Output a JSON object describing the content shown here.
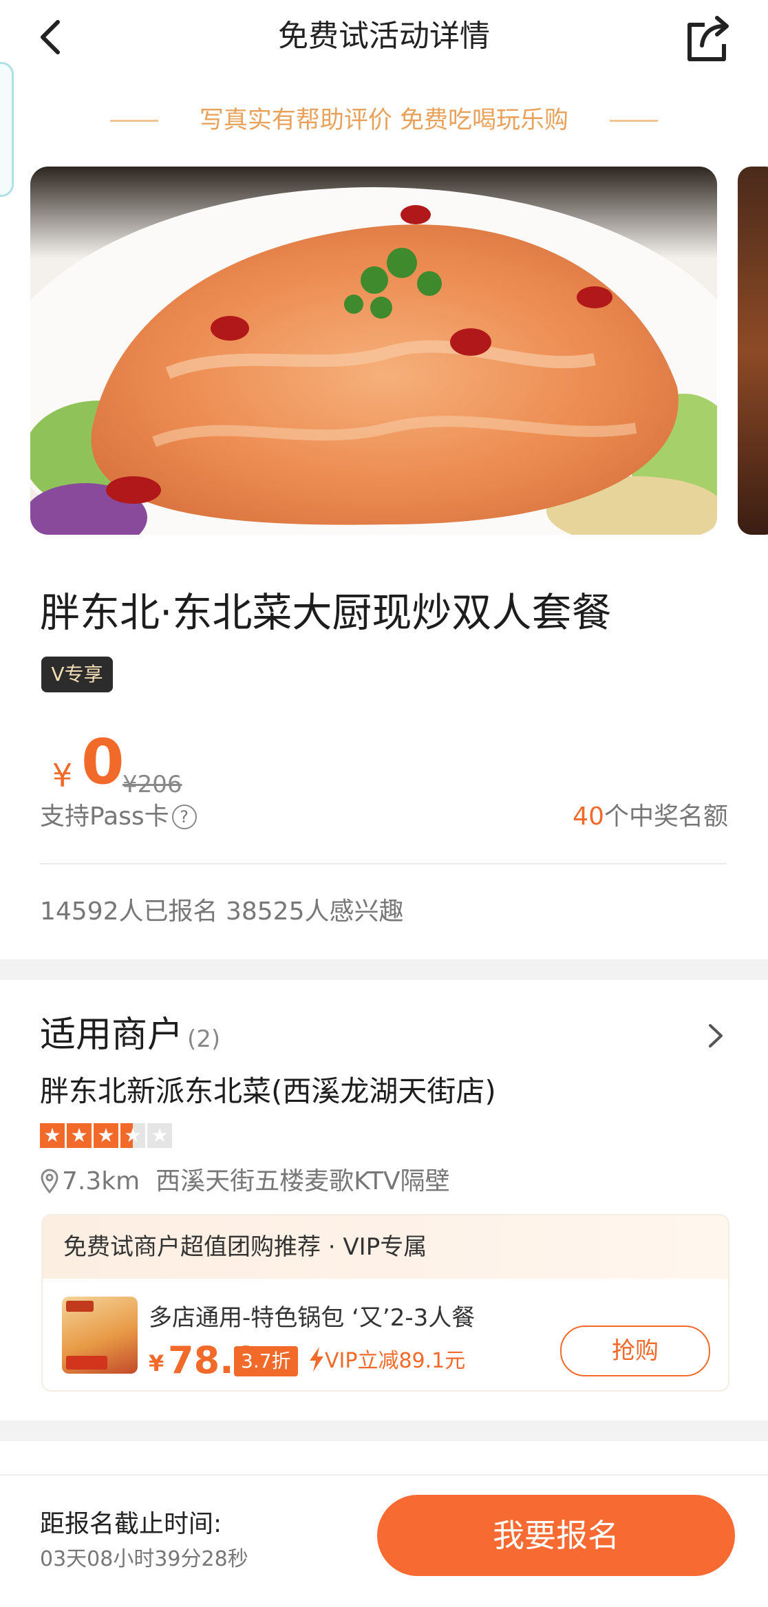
{
  "header": {
    "title": "免费试活动详情"
  },
  "slogan": "写真实有帮助评价 免费吃喝玩乐购",
  "product": {
    "name": "胖东北·东北菜大厨现炒双人套餐",
    "badge": "V专享",
    "currency": "¥",
    "price": "0",
    "original_price": "¥206",
    "pass_text": "支持Pass卡",
    "quota_number": "40",
    "quota_suffix": "个中奖名额",
    "stats": "14592人已报名  38525人感兴趣"
  },
  "merchants": {
    "title": "适用商户",
    "count": "(2)",
    "shop_name": "胖东北新派东北菜(西溪龙湖天街店)",
    "rating": 3.5,
    "rating_max": 5,
    "distance": "7.3km",
    "address": "西溪天街五楼麦歌KTV隔壁"
  },
  "deal": {
    "header": "免费试商户超值团购推荐 · VIP专属",
    "name": "多店通用-特色锅包 ‘又’2-3人餐",
    "currency": "¥",
    "price": "78.9",
    "discount": "3.7折",
    "vip": "VIP立减89.1元",
    "buy_label": "抢购"
  },
  "footer": {
    "deadline_label": "距报名截止时间:",
    "deadline_value": "03天08小时39分28秒",
    "signup_label": "我要报名"
  },
  "colors": {
    "accent": "#f26a2a",
    "signup": "#f76a32",
    "slogan": "#e8a25b"
  },
  "icons": [
    "back-arrow-icon",
    "share-icon",
    "help-circle-icon",
    "chevron-right-icon",
    "location-pin-icon",
    "lightning-icon",
    "star-icon"
  ]
}
